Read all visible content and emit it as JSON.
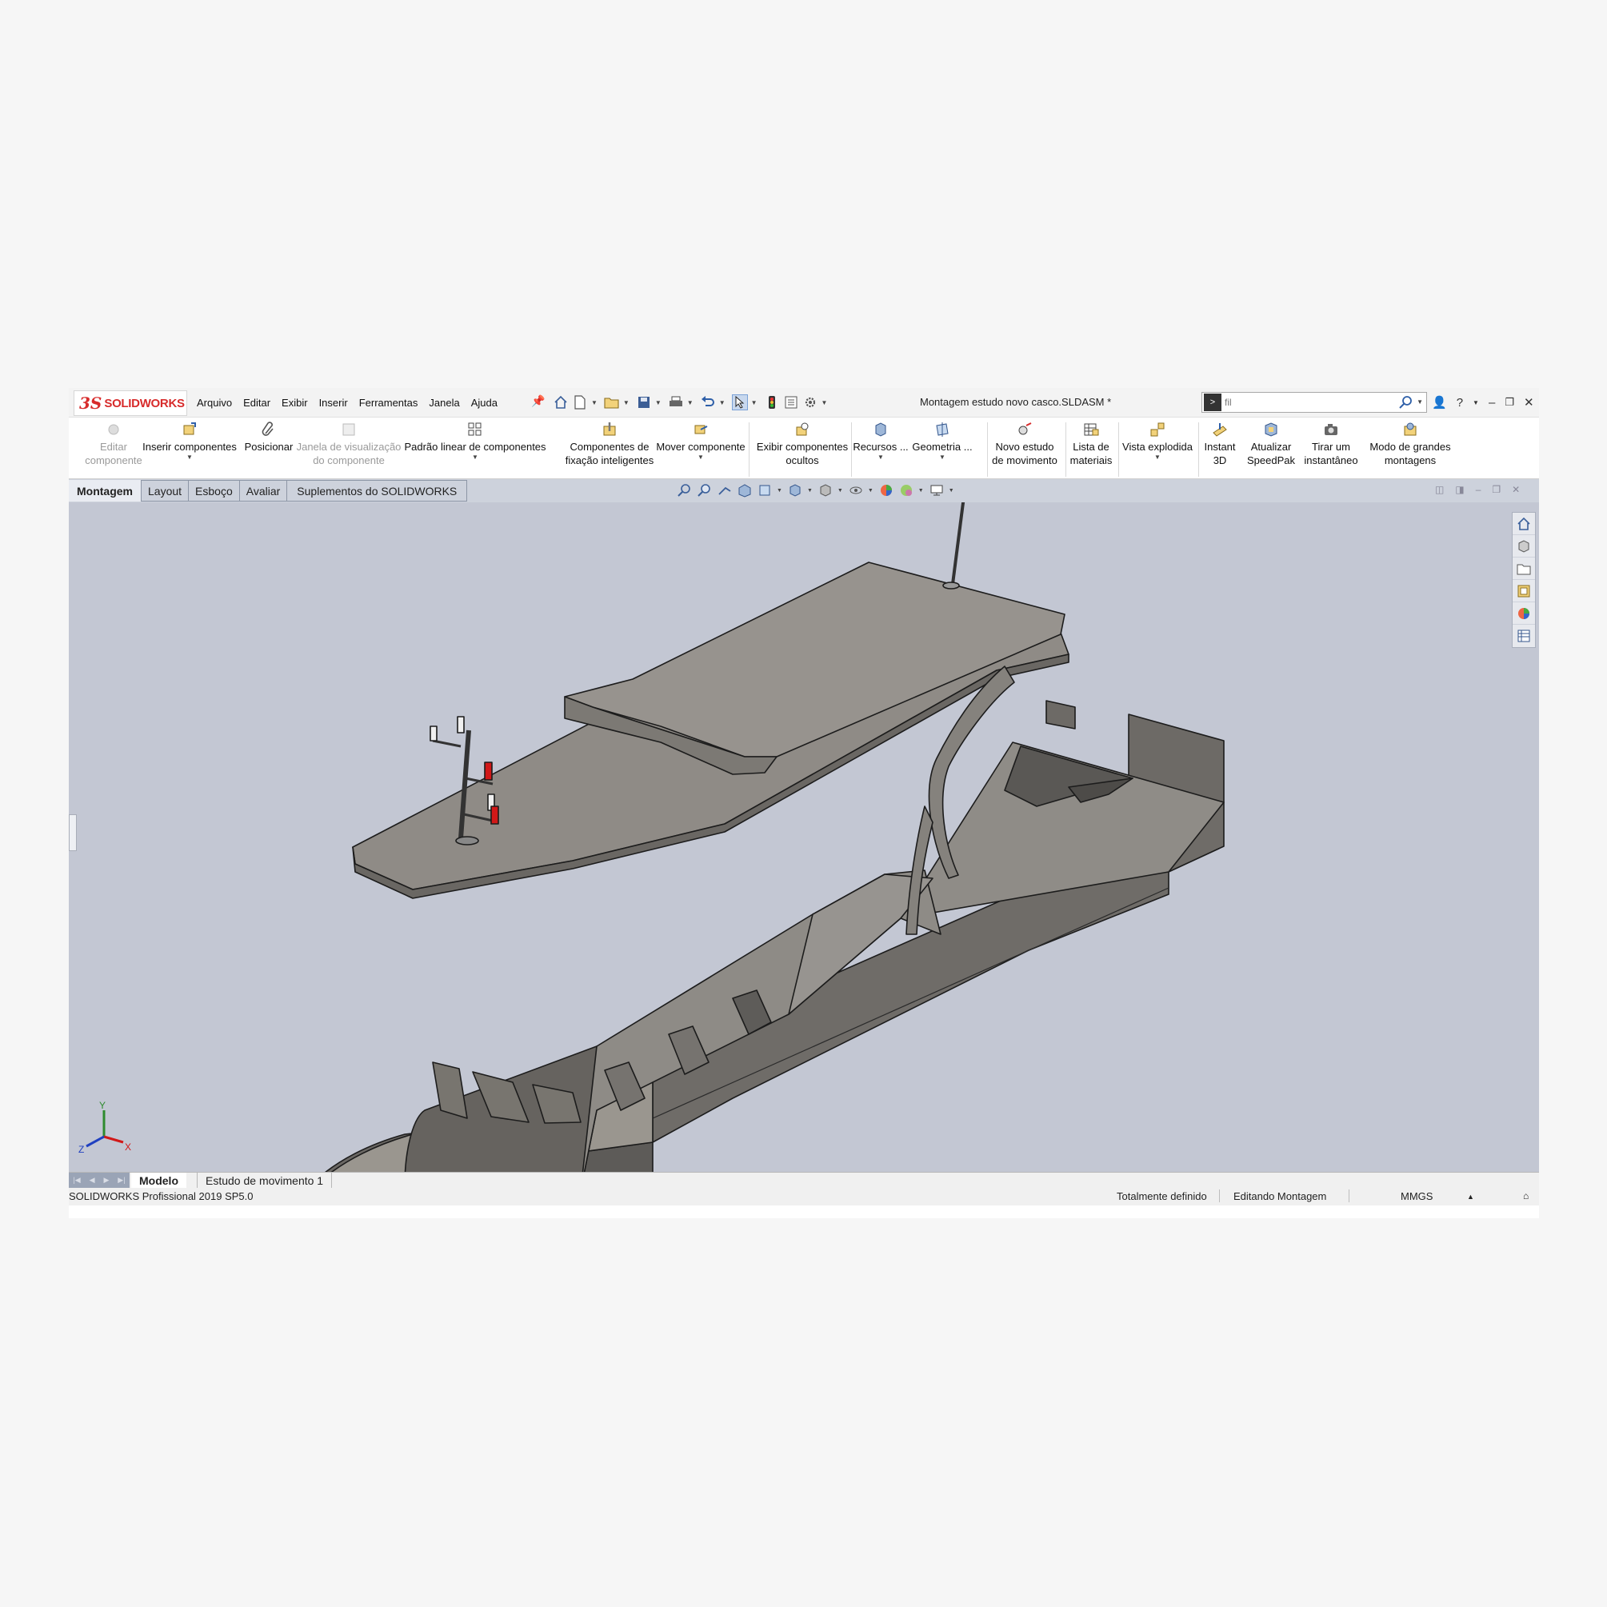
{
  "app": {
    "logo_text": "SOLIDWORKS",
    "document_title": "Montagem estudo novo casco.SLDASM *",
    "menu": [
      "Arquivo",
      "Editar",
      "Exibir",
      "Inserir",
      "Ferramentas",
      "Janela",
      "Ajuda"
    ],
    "search": {
      "value": "fil"
    }
  },
  "command_manager": {
    "buttons": [
      {
        "label1": "Editar",
        "label2": "componente",
        "disabled": true
      },
      {
        "label1": "Inserir componentes",
        "label2": "",
        "disabled": false
      },
      {
        "label1": "Posicionar",
        "label2": "",
        "disabled": false
      },
      {
        "label1": "Janela de visualização",
        "label2": "do componente",
        "disabled": true
      },
      {
        "label1": "Padrão linear de componentes",
        "label2": "",
        "disabled": false
      },
      {
        "label1": "Componentes de",
        "label2": "fixação inteligentes",
        "disabled": false
      },
      {
        "label1": "Mover componente",
        "label2": "",
        "disabled": false
      },
      {
        "label1": "Exibir componentes",
        "label2": "ocultos",
        "disabled": false
      },
      {
        "label1": "Recursos ...",
        "label2": "",
        "disabled": false
      },
      {
        "label1": "Geometria ...",
        "label2": "",
        "disabled": false
      },
      {
        "label1": "Novo estudo",
        "label2": "de movimento",
        "disabled": false
      },
      {
        "label1": "Lista de",
        "label2": "materiais",
        "disabled": false
      },
      {
        "label1": "Vista explodida",
        "label2": "",
        "disabled": false
      },
      {
        "label1": "Instant",
        "label2": "3D",
        "disabled": false
      },
      {
        "label1": "Atualizar",
        "label2": "SpeedPak",
        "disabled": false
      },
      {
        "label1": "Tirar um",
        "label2": "instantâneo",
        "disabled": false
      },
      {
        "label1": "Modo de grandes",
        "label2": "montagens",
        "disabled": false
      }
    ]
  },
  "tabs": [
    "Montagem",
    "Layout",
    "Esboço",
    "Avaliar",
    "Suplementos do SOLIDWORKS"
  ],
  "active_tab": "Montagem",
  "triad": {
    "x": "X",
    "y": "Y",
    "z": "Z"
  },
  "bottom_tabs": [
    "Modelo",
    "Estudo de movimento 1"
  ],
  "status": {
    "product": "SOLIDWORKS Profissional 2019 SP5.0",
    "definition": "Totalmente definido",
    "mode": "Editando Montagem",
    "units": "MMGS"
  },
  "colors": {
    "viewport_bg": "#c3c7d3",
    "brand": "#d72b2b",
    "model_gray": "#8f8b86",
    "warning_red": "#d11818"
  }
}
